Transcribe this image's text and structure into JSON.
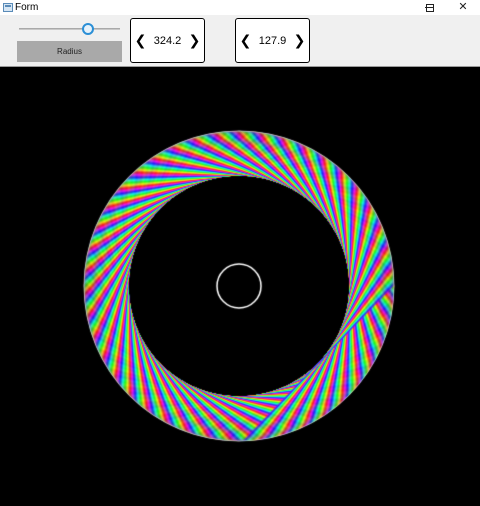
{
  "window": {
    "title": "Form",
    "controls": {
      "minimize": "minimize-icon",
      "maximize": "maximize-icon",
      "close": "close-icon"
    }
  },
  "toolbar": {
    "slider": {
      "fraction": 0.68
    },
    "radius_label": "Radius",
    "stepper_left": {
      "value": "324.2",
      "prev_icon": "chevron-left-icon",
      "next_icon": "chevron-right-icon"
    },
    "stepper_right": {
      "value": "127.9",
      "prev_icon": "chevron-left-icon",
      "next_icon": "chevron-right-icon"
    }
  },
  "canvas": {
    "background": "#000000",
    "palette": [
      "#ff2a6a",
      "#ffb000",
      "#ffff40",
      "#40ff40",
      "#00ffff",
      "#4040ff",
      "#ff40ff"
    ]
  }
}
